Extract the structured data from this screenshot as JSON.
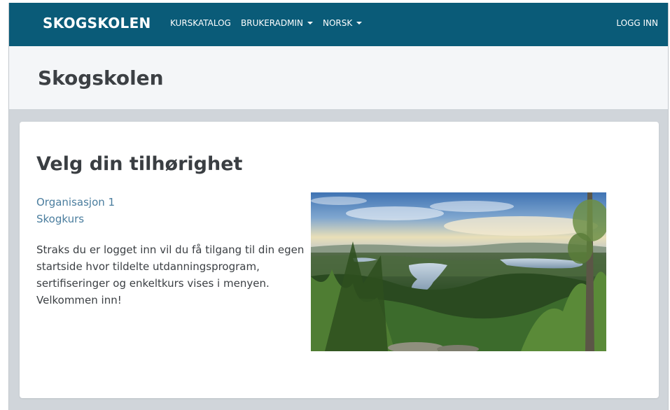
{
  "navbar": {
    "brand": "SKOGSKOLEN",
    "items": [
      {
        "label": "KURSKATALOG"
      },
      {
        "label": "BRUKERADMIN"
      },
      {
        "label": "NORSK"
      }
    ],
    "login": "LOGG INN"
  },
  "header": {
    "title": "Skogskolen"
  },
  "card": {
    "heading": "Velg din tilhørighet",
    "links": [
      "Organisasjon 1",
      "Skogkurs"
    ],
    "intro": "Straks du er logget inn vil du få tilgang til din egen startside hvor tildelte utdanningsprogram, sertifiseringer og enkeltkurs vises i menyen. Velkommen inn!"
  },
  "colors": {
    "navbar": "#0a5b78",
    "header_band": "#f4f6f8",
    "page_bg": "#d0d5da",
    "link": "#4a7d9e"
  }
}
